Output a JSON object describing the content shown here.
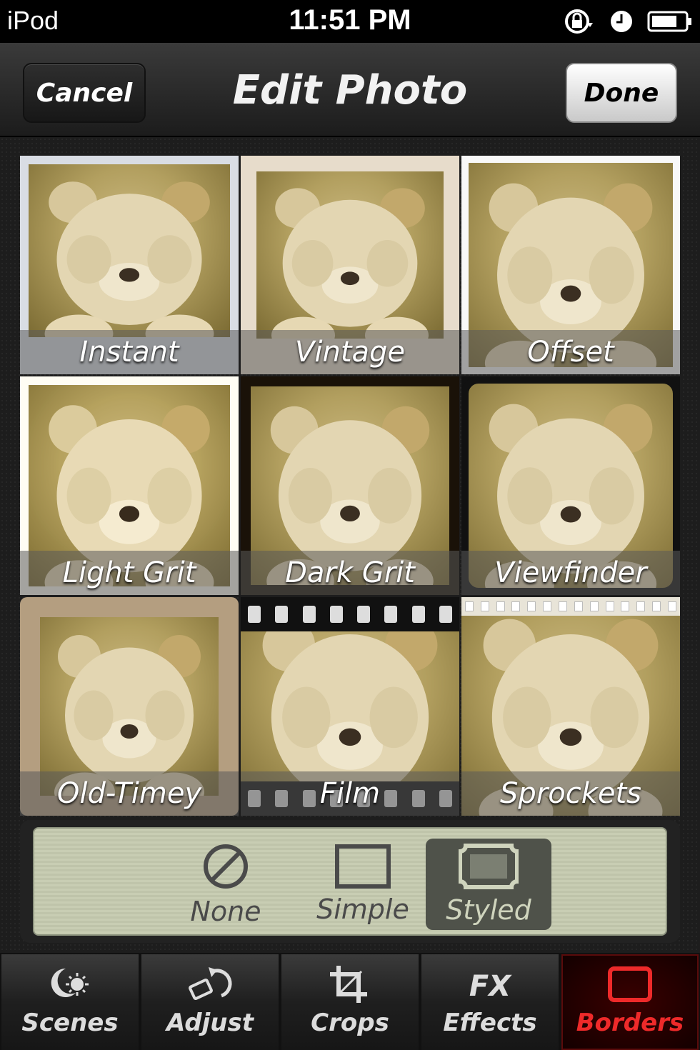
{
  "status_bar": {
    "carrier": "iPod",
    "time": "11:51 PM"
  },
  "nav": {
    "title": "Edit Photo",
    "cancel_label": "Cancel",
    "done_label": "Done"
  },
  "borders": [
    {
      "label": "Instant"
    },
    {
      "label": "Vintage"
    },
    {
      "label": "Offset"
    },
    {
      "label": "Light Grit"
    },
    {
      "label": "Dark Grit"
    },
    {
      "label": "Viewfinder"
    },
    {
      "label": "Old-Timey"
    },
    {
      "label": "Film"
    },
    {
      "label": "Sprockets"
    }
  ],
  "segments": {
    "selected": "Styled",
    "items": [
      {
        "label": "None",
        "icon": "no-symbol-icon"
      },
      {
        "label": "Simple",
        "icon": "simple-frame-icon"
      },
      {
        "label": "Styled",
        "icon": "styled-frame-icon"
      }
    ]
  },
  "tabs": {
    "active": "Borders",
    "items": [
      {
        "label": "Scenes",
        "icon": "sun-moon-icon"
      },
      {
        "label": "Adjust",
        "icon": "rotate-icon"
      },
      {
        "label": "Crops",
        "icon": "crop-icon"
      },
      {
        "label": "Effects",
        "icon": "fx-icon"
      },
      {
        "label": "Borders",
        "icon": "frame-icon"
      }
    ]
  },
  "colors": {
    "accent_active_tab": "#ee2a2a",
    "panel_green": "#c8cdb3"
  }
}
